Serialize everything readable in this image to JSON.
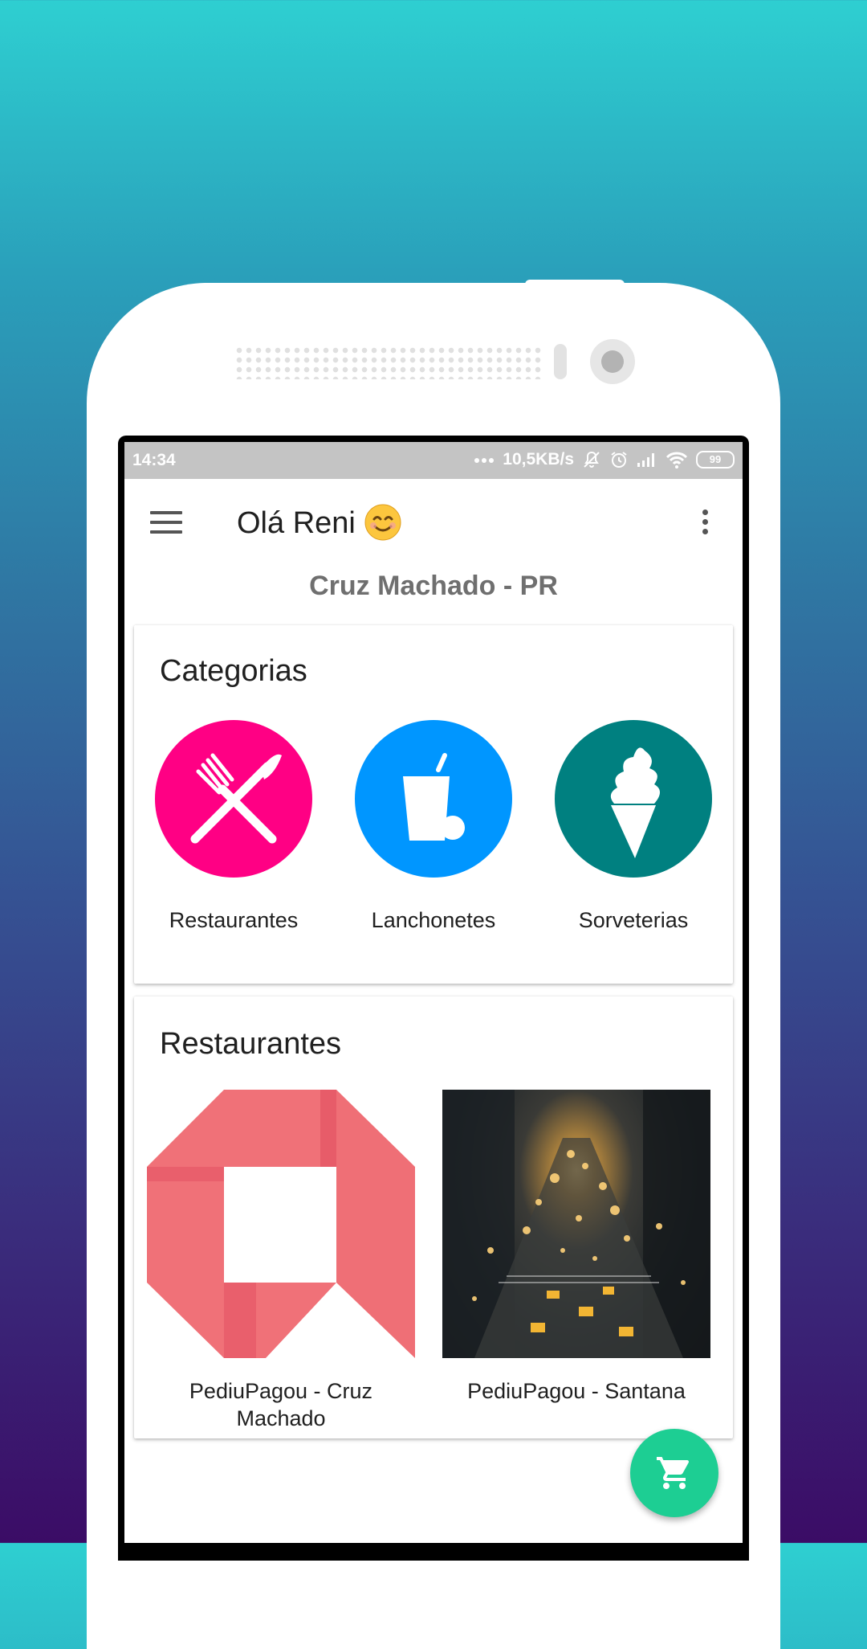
{
  "status_bar": {
    "time": "14:34",
    "network_speed": "10,5KB/s",
    "battery_level": "99",
    "icons": [
      "more-dots-icon",
      "mute-icon",
      "alarm-icon",
      "signal-icon",
      "wifi-icon",
      "battery-icon"
    ]
  },
  "app_bar": {
    "title": "Olá Reni",
    "emoji_icon": "smiley-icon",
    "menu_icon": "menu-icon",
    "overflow_icon": "more-vert-icon"
  },
  "location": "Cruz Machado - PR",
  "categories": {
    "title": "Categorias",
    "items": [
      {
        "label": "Restaurantes",
        "icon": "fork-knife-icon",
        "color": "#ff0084"
      },
      {
        "label": "Lanchonetes",
        "icon": "drink-cup-icon",
        "color": "#0096ff"
      },
      {
        "label": "Sorveterias",
        "icon": "ice-cream-icon",
        "color": "#008080"
      }
    ]
  },
  "restaurants": {
    "title": "Restaurantes",
    "items": [
      {
        "label": "PediuPagou - Cruz Machado",
        "image": "pediupagou-logo"
      },
      {
        "label": "PediuPagou - Santana",
        "image": "city-street-photo"
      }
    ]
  },
  "fab": {
    "icon": "cart-icon",
    "color": "#1dce93"
  }
}
